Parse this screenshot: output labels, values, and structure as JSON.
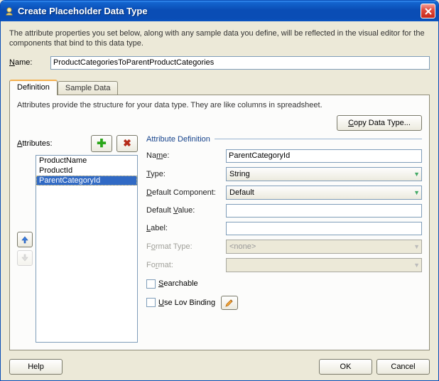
{
  "window": {
    "title": "Create Placeholder Data Type"
  },
  "intro": "The attribute properties you set below, along with any sample data you define, will be reflected in the visual editor for the components that bind to this data type.",
  "name_label": "Name:",
  "name_value": "ProductCategoriesToParentProductCategories",
  "tabs": {
    "definition": "Definition",
    "sample_data": "Sample Data",
    "intro": "Attributes provide the structure for your data type. They are like columns in spreadsheet."
  },
  "copy_btn": "Copy Data Type...",
  "attributes_label": "Attributes:",
  "attributes": [
    {
      "name": "ProductName"
    },
    {
      "name": "ProductId"
    },
    {
      "name": "ParentCategoryId"
    }
  ],
  "selected_attribute_index": 2,
  "section_title": "Attribute Definition",
  "form": {
    "name_label": "Name:",
    "name_value": "ParentCategoryId",
    "type_label": "Type:",
    "type_value": "String",
    "default_component_label": "Default Component:",
    "default_component_value": "Default",
    "default_value_label": "Default Value:",
    "default_value_value": "",
    "label_label": "Label:",
    "label_value": "",
    "format_type_label": "Format Type:",
    "format_type_value": "<none>",
    "format_label": "Format:",
    "format_value": "",
    "searchable_label": "Searchable",
    "use_lov_label": "Use Lov Binding"
  },
  "footer": {
    "help": "Help",
    "ok": "OK",
    "cancel": "Cancel"
  },
  "icons": {
    "plus": "plus-icon",
    "delete": "delete-icon",
    "up": "arrow-up-icon",
    "down": "arrow-down-icon",
    "close": "close-icon",
    "pencil": "pencil-icon"
  }
}
